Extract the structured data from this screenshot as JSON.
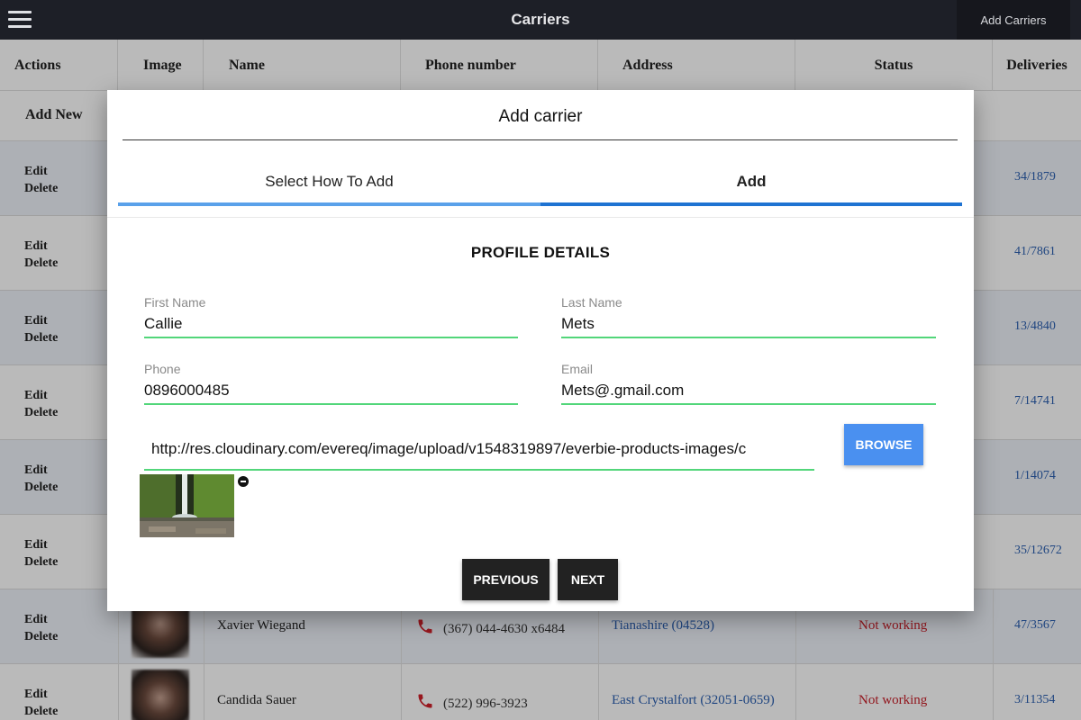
{
  "header": {
    "menu_icon": "hamburger-icon",
    "title": "Carriers",
    "add_button": "Add Carriers"
  },
  "table": {
    "columns": [
      "Actions",
      "Image",
      "Name",
      "Phone number",
      "Address",
      "Status",
      "Deliveries"
    ],
    "add_new_label": "Add New",
    "edit_label": "Edit",
    "delete_label": "Delete",
    "rows": [
      {
        "name": "",
        "phone": "",
        "address": "",
        "status": "",
        "deliveries": "34/1879"
      },
      {
        "name": "",
        "phone": "",
        "address": "",
        "status": "",
        "deliveries": "41/7861"
      },
      {
        "name": "",
        "phone": "",
        "address": "",
        "status": "",
        "deliveries": "13/4840"
      },
      {
        "name": "",
        "phone": "",
        "address": "",
        "status": "",
        "deliveries": "7/14741"
      },
      {
        "name": "",
        "phone": "",
        "address": "",
        "status": "",
        "deliveries": "1/14074"
      },
      {
        "name": "",
        "phone": "",
        "address": "",
        "status": "",
        "deliveries": "35/12672"
      },
      {
        "name": "Xavier Wiegand",
        "phone": "(367) 044-4630 x6484",
        "address": "Tianashire (04528)",
        "status": "Not working",
        "deliveries": "47/3567"
      },
      {
        "name": "Candida Sauer",
        "phone": "(522) 996-3923",
        "address": "East Crystalfort (32051-0659)",
        "status": "Not working",
        "deliveries": "3/11354"
      }
    ]
  },
  "modal": {
    "title": "Add carrier",
    "steps": [
      {
        "label": "Select How To Add",
        "active": false
      },
      {
        "label": "Add",
        "active": true
      }
    ],
    "section_title": "PROFILE DETAILS",
    "fields": {
      "first_name": {
        "label": "First Name",
        "value": "Callie"
      },
      "last_name": {
        "label": "Last Name",
        "value": "Mets"
      },
      "phone": {
        "label": "Phone",
        "value": "0896000485"
      },
      "email": {
        "label": "Email",
        "value": "Mets@.gmail.com"
      }
    },
    "image_url": "http://res.cloudinary.com/evereq/image/upload/v1548319897/everbie-products-images/c",
    "browse_label": "BROWSE",
    "previous_label": "PREVIOUS",
    "next_label": "NEXT"
  },
  "colors": {
    "topbar": "#1d1f27",
    "step_bar_light": "#5aa1ea",
    "step_bar_active": "#1f73d2",
    "input_underline": "#52d67a",
    "browse_button": "#4a90f0",
    "nav_button": "#222222",
    "link": "#2b5fb0",
    "status_error": "#c8202a"
  }
}
